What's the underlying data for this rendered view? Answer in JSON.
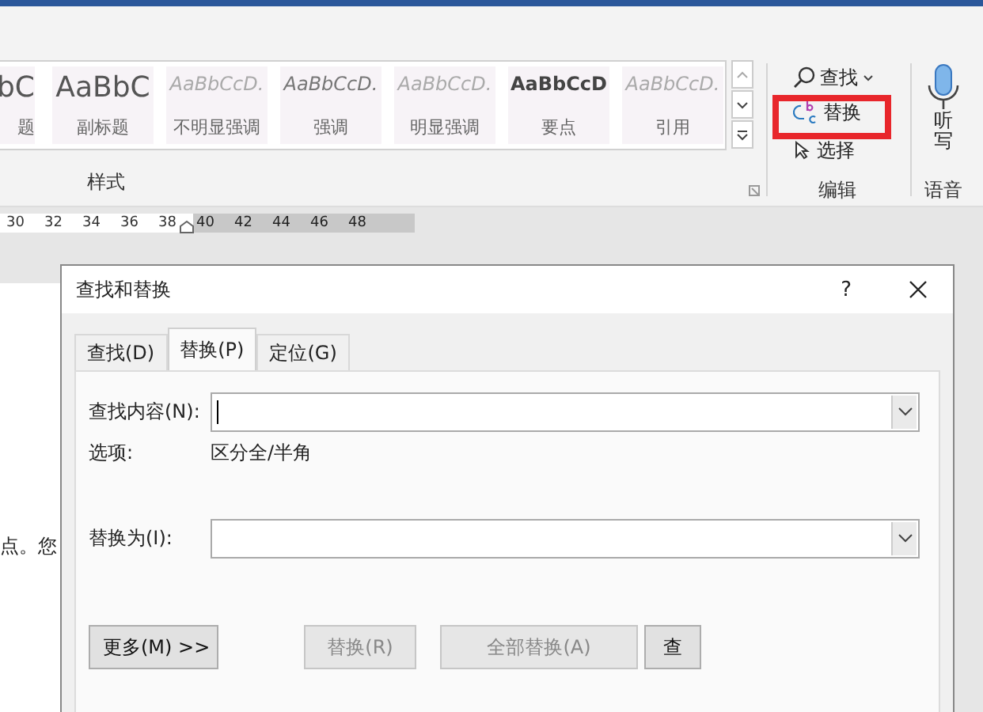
{
  "ribbon": {
    "styles": [
      {
        "sample": "bC",
        "name": "题",
        "kind": "heading"
      },
      {
        "sample": "AaBbC",
        "name": "副标题",
        "kind": "heading"
      },
      {
        "sample": "AaBbCcD.",
        "name": "不明显强调",
        "kind": "faint"
      },
      {
        "sample": "AaBbCcD.",
        "name": "强调",
        "kind": "italic"
      },
      {
        "sample": "AaBbCcD.",
        "name": "明显强调",
        "kind": "faint"
      },
      {
        "sample": "AaBbCcD",
        "name": "要点",
        "kind": "bold"
      },
      {
        "sample": "AaBbCcD.",
        "name": "引用",
        "kind": "faint"
      }
    ],
    "styles_label": "样式",
    "editing": {
      "find": "查找",
      "replace": "替换",
      "select": "选择",
      "label": "编辑",
      "highlighted": true
    },
    "voice": {
      "dictate": "听写",
      "label": "语音"
    }
  },
  "ruler": {
    "ticks": [
      {
        "label": "30",
        "margin": false
      },
      {
        "label": "32",
        "margin": false
      },
      {
        "label": "34",
        "margin": false
      },
      {
        "label": "36",
        "margin": false
      },
      {
        "label": "38",
        "margin": false
      },
      {
        "label": "40",
        "margin": true
      },
      {
        "label": "42",
        "margin": true
      },
      {
        "label": "44",
        "margin": true
      },
      {
        "label": "46",
        "margin": true
      },
      {
        "label": "48",
        "margin": true
      }
    ]
  },
  "document": {
    "text": "点。您"
  },
  "dialog": {
    "title": "查找和替换",
    "help": "?",
    "tabs": [
      {
        "label": "查找(D)",
        "selected": false
      },
      {
        "label": "替换(P)",
        "selected": true
      },
      {
        "label": "定位(G)",
        "selected": false
      }
    ],
    "find_label": "查找内容(N):",
    "options_label": "选项:",
    "options_value": "区分全/半角",
    "replace_label": "替换为(I):",
    "buttons": [
      {
        "label": "更多(M) >>",
        "disabled": false,
        "kind": "more"
      },
      {
        "label": "替换(R)",
        "disabled": true,
        "kind": "action"
      },
      {
        "label": "全部替换(A)",
        "disabled": true,
        "kind": "action"
      },
      {
        "label": "查",
        "disabled": false,
        "kind": "action"
      }
    ]
  }
}
